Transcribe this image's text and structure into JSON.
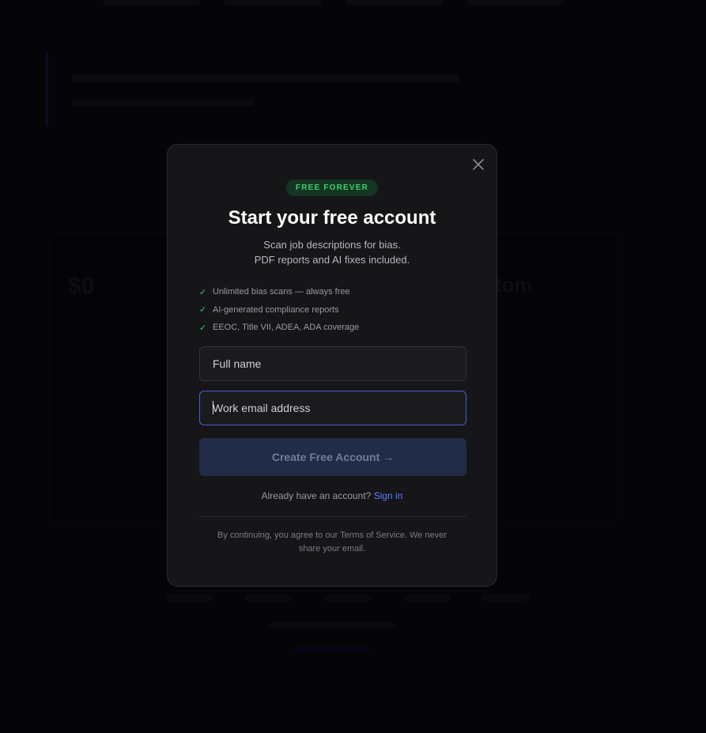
{
  "modal": {
    "badge": "FREE FOREVER",
    "title": "Start your free account",
    "subtitle_line1": "Scan job descriptions for bias.",
    "subtitle_line2": "PDF reports and AI fixes included.",
    "features": [
      "Unlimited bias scans — always free",
      "AI-generated compliance reports",
      "EEOC, Title VII, ADEA, ADA coverage"
    ],
    "check_glyph": "✓",
    "name_placeholder": "Full name",
    "name_value": "",
    "email_placeholder": "Work email address",
    "email_value": "",
    "submit_label": "Create Free Account →",
    "signin_prompt": "Already have an account?",
    "signin_link": "Sign in",
    "legal": "By continuing, you agree to our Terms of Service. We never share your email.",
    "close_icon": "close-icon"
  },
  "background": {
    "price_left": "$0",
    "price_right": "tom"
  },
  "colors": {
    "accent": "#5b7cff",
    "focus_border": "#4a5ce0",
    "badge_bg": "#143524",
    "badge_text": "#3ccf6b",
    "check": "#38c46a",
    "button_bg": "#222c48"
  }
}
